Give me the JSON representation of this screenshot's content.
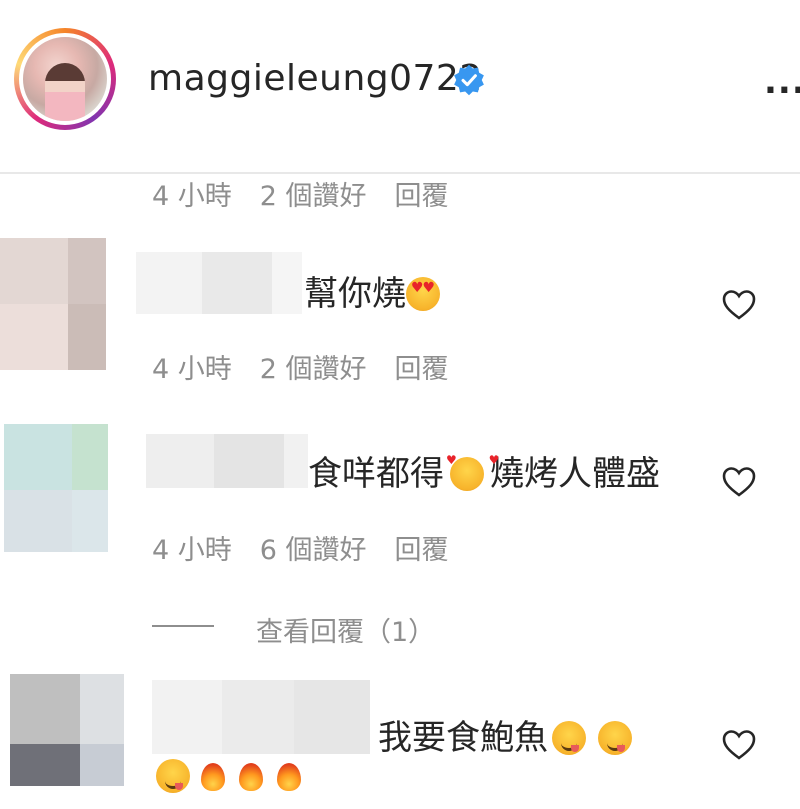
{
  "header": {
    "username": "maggieleung0722",
    "more_label": "..."
  },
  "comments": [
    {
      "time": "4 小時",
      "likes": "2 個讚好",
      "reply": "回覆"
    },
    {
      "text": "幫你燒",
      "emoji": [
        "heart-eyes"
      ],
      "time": "4 小時",
      "likes": "2 個讚好",
      "reply": "回覆"
    },
    {
      "text_before": "食咩都得",
      "emoji": [
        "smiling-face-with-hearts"
      ],
      "text_after": "燒烤人體盛",
      "time": "4 小時",
      "likes": "6 個讚好",
      "reply": "回覆",
      "view_replies": "查看回覆（1）"
    },
    {
      "text": "我要食鮑魚",
      "emoji_line1": [
        "yum",
        "yum"
      ],
      "emoji_line2": [
        "yum",
        "fire",
        "fire",
        "fire"
      ]
    }
  ],
  "colors": {
    "text": "#262626",
    "secondary": "#8e8e8e",
    "verified": "#3897f0"
  }
}
